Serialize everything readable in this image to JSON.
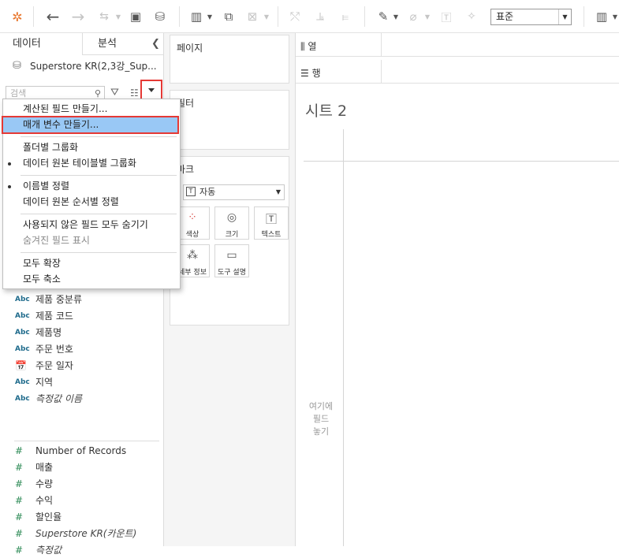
{
  "toolbar": {
    "view_select": "표준"
  },
  "left_panel": {
    "tabs": [
      "데이터",
      "분석"
    ],
    "datasource": "Superstore KR(2,3강_Sup...",
    "search_placeholder": "검색"
  },
  "menu": {
    "items": [
      {
        "label": "계산된 필드 만들기..."
      },
      {
        "label": "매개 변수 만들기..."
      },
      {
        "label": "폴더별 그룹화"
      },
      {
        "label": "데이터 원본 테이블별 그룹화"
      },
      {
        "label": "이름별 정렬"
      },
      {
        "label": "데이터 원본 순서별 정렬"
      },
      {
        "label": "사용되지 않은 필드 모두 숨기기"
      },
      {
        "label": "숨겨진 필드 표시"
      },
      {
        "label": "모두 확장"
      },
      {
        "label": "모두 축소"
      }
    ]
  },
  "dimensions": [
    {
      "icon": "Abc",
      "label": "제품 중분류"
    },
    {
      "icon": "Abc",
      "label": "제품 코드"
    },
    {
      "icon": "Abc",
      "label": "제품명"
    },
    {
      "icon": "Abc",
      "label": "주문 번호"
    },
    {
      "icon": "calendar-icon",
      "label": "주문 일자"
    },
    {
      "icon": "Abc",
      "label": "지역"
    },
    {
      "icon": "Abc",
      "label": "측정값 이름"
    }
  ],
  "measures": [
    {
      "label": "Number of Records"
    },
    {
      "label": "매출"
    },
    {
      "label": "수량"
    },
    {
      "label": "수익"
    },
    {
      "label": "할인율"
    },
    {
      "label": "Superstore KR(카운트)"
    },
    {
      "label": "측정값"
    }
  ],
  "cards": {
    "pages": "페이지",
    "filters": "필터",
    "marks": "마크",
    "marks_type": "자동",
    "marks_buttons": [
      "색상",
      "크기",
      "텍스트",
      "세부 정보",
      "도구 설명"
    ]
  },
  "shelves": {
    "columns": "열",
    "rows": "행"
  },
  "sheet": {
    "title": "시트 2",
    "drop_hint": [
      "여기에",
      "필드",
      "놓기"
    ]
  }
}
